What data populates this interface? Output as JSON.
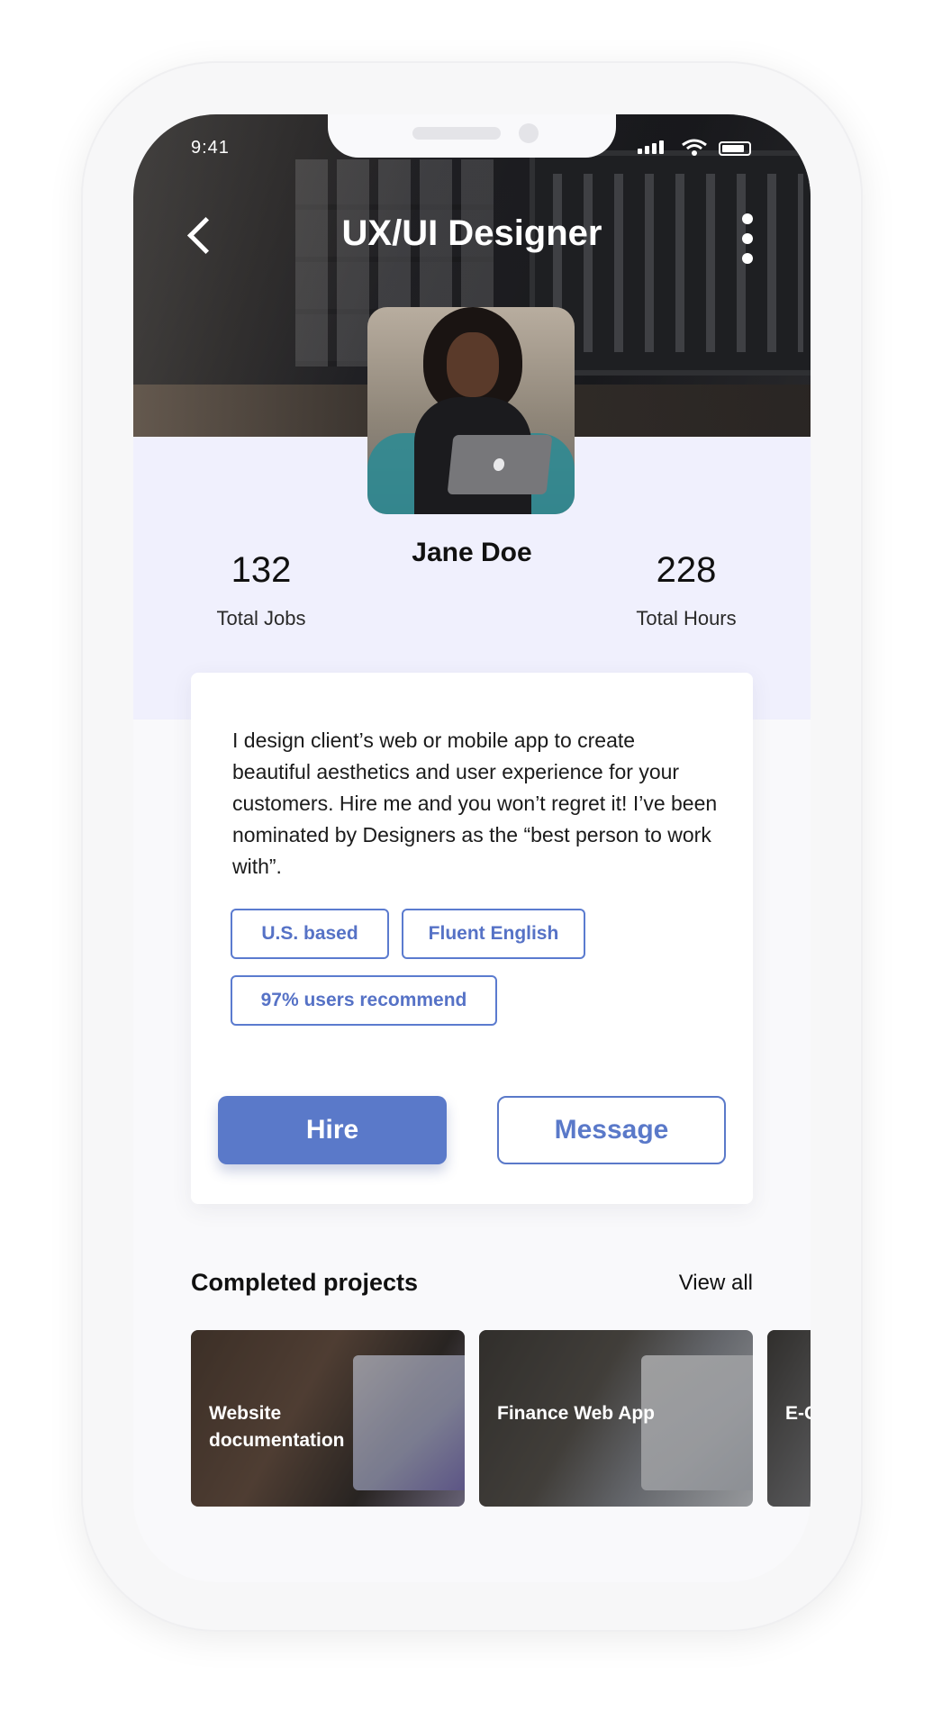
{
  "status_bar": {
    "time": "9:41"
  },
  "header": {
    "title": "UX/UI Designer"
  },
  "profile": {
    "name": "Jane Doe",
    "stats": [
      {
        "value": "132",
        "label": "Total Jobs"
      },
      {
        "value": "228",
        "label": "Total Hours"
      }
    ]
  },
  "card": {
    "bio": "I design client’s web or mobile app to create beautiful aesthetics and user experience for your customers. Hire me and you won’t regret it! I’ve been nominated by Designers as the “best person to work with”.",
    "tags": [
      "U.S. based",
      "Fluent English",
      "97% users recommend"
    ],
    "hire_label": "Hire",
    "message_label": "Message"
  },
  "projects": {
    "title": "Completed projects",
    "view_all": "View all",
    "items": [
      {
        "label": "Website documentation"
      },
      {
        "label": "Finance Web App"
      },
      {
        "label": "E-C"
      }
    ]
  },
  "colors": {
    "accent": "#5a79c9",
    "band": "#f0f0fd"
  },
  "icons": {
    "back": "back-arrow-icon",
    "more": "more-vertical-icon",
    "signal": "signal-icon",
    "wifi": "wifi-icon",
    "battery": "battery-icon"
  }
}
